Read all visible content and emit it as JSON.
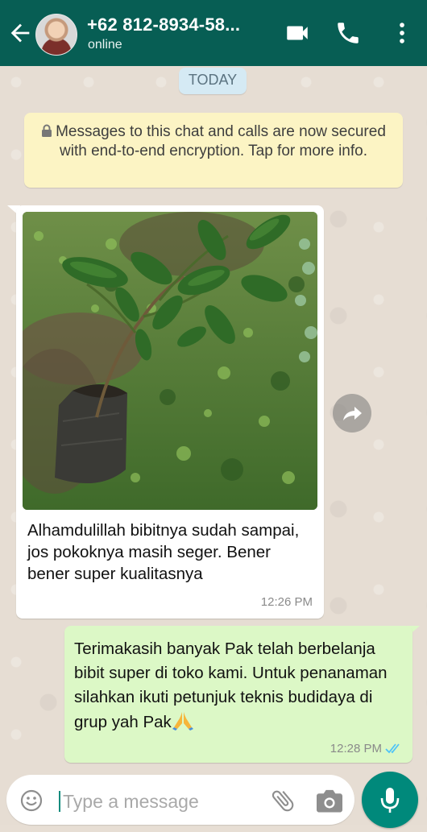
{
  "header": {
    "contact_name": "+62 812-8934-58...",
    "status": "online"
  },
  "chat": {
    "date_chip": "TODAY",
    "encryption_notice": "Messages to this chat and calls are now secured with end-to-end encryption. Tap for more info.",
    "messages": [
      {
        "direction": "incoming",
        "type": "image",
        "text": "Alhamdulillah bibitnya sudah sampai, jos pokoknya masih seger. Bener bener super kualitasnya",
        "time": "12:26 PM"
      },
      {
        "direction": "outgoing",
        "type": "text",
        "text": "Terimakasih banyak Pak telah berbelanja bibit super di toko kami. Untuk penanaman silahkan ikuti petunjuk teknis budidaya di grup yah Pak",
        "time": "12:28 PM",
        "status": "read"
      }
    ]
  },
  "composer": {
    "placeholder": "Type a message"
  },
  "colors": {
    "header": "#075e54",
    "outgoing_bubble": "#dcf8c6",
    "incoming_bubble": "#ffffff",
    "encryption_bg": "#fcf4c4",
    "date_chip_bg": "#d5eaf4",
    "fab": "#00897b",
    "read_ticks": "#4fc3f7"
  },
  "icons": [
    "back-arrow-icon",
    "video-call-icon",
    "phone-icon",
    "more-vert-icon",
    "lock-icon",
    "forward-icon",
    "double-check-icon",
    "emoji-icon",
    "attach-icon",
    "camera-icon",
    "mic-icon",
    "folded-hands-emoji"
  ]
}
